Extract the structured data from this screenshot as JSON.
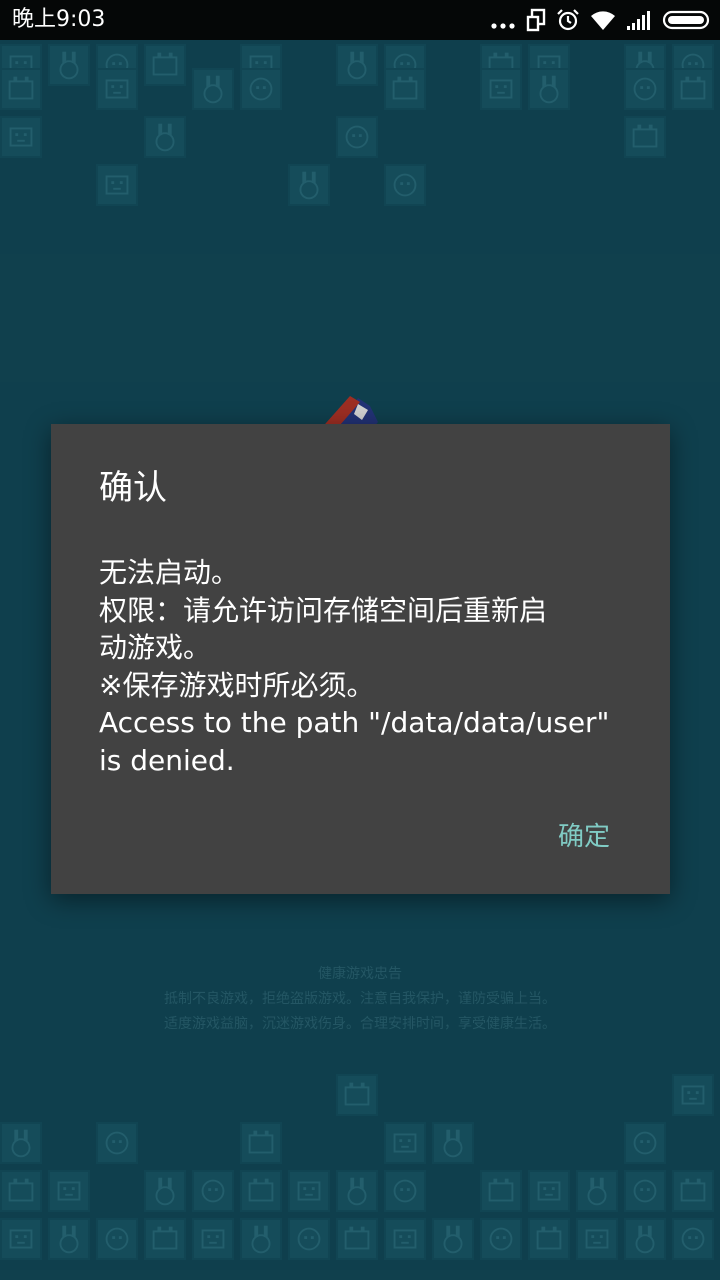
{
  "status_bar": {
    "time": "晚上9:03",
    "icons": [
      "more-dots-icon",
      "screen-rotate-icon",
      "alarm-icon",
      "wifi-icon",
      "signal-icon",
      "battery-icon"
    ]
  },
  "health_notice": {
    "title": "健康游戏忠告",
    "line1": "抵制不良游戏，拒绝盗版游戏。注意自我保护，谨防受骗上当。",
    "line2": "适度游戏益脑，沉迷游戏伤身。合理安排时间，享受健康生活。"
  },
  "dialog": {
    "title": "确认",
    "message_lines": [
      "无法启动。",
      "权限：请允许访问存储空间后重新启",
      "动游戏。",
      "※保存游戏时所必须。",
      "Access to the path \"/data/data/user\"",
      "is denied."
    ],
    "ok_label": "确定"
  },
  "colors": {
    "background": "#134e5e",
    "tile": "#1a5d6e",
    "dialog": "#424242",
    "accent": "#80cbc4"
  }
}
